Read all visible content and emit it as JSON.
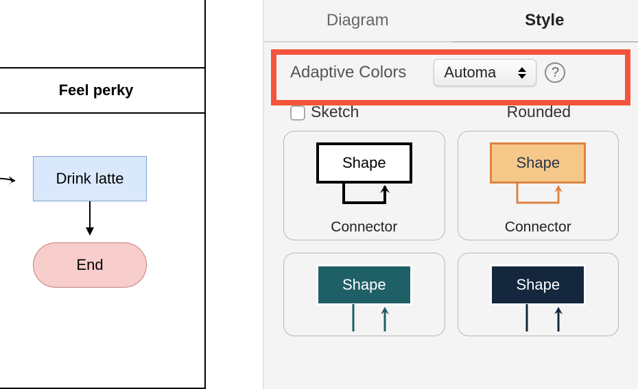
{
  "canvas": {
    "header_cell": "Feel perky",
    "node_rect": "Drink latte",
    "node_end": "End"
  },
  "panel": {
    "tabs": {
      "diagram": "Diagram",
      "style": "Style"
    },
    "adaptive": {
      "label": "Adaptive Colors",
      "value": "Automa",
      "help": "?"
    },
    "options": {
      "sketch": "Sketch",
      "rounded": "Rounded"
    },
    "swatches": [
      {
        "shape_label": "Shape",
        "connector_label": "Connector"
      },
      {
        "shape_label": "Shape",
        "connector_label": "Connector"
      },
      {
        "shape_label": "Shape",
        "connector_label": ""
      },
      {
        "shape_label": "Shape",
        "connector_label": ""
      }
    ]
  }
}
